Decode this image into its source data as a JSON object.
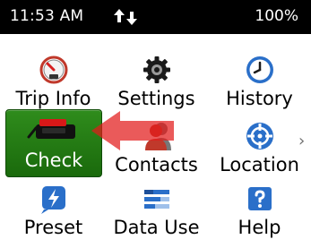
{
  "status_bar": {
    "time": "11:53 AM",
    "battery": "100%"
  },
  "menu": {
    "tiles": [
      {
        "label": "Trip Info",
        "icon": "speedometer-icon"
      },
      {
        "label": "Settings",
        "icon": "gear-icon"
      },
      {
        "label": "History",
        "icon": "clock-icon"
      },
      {
        "label": "Check",
        "icon": "handset-icon",
        "selected": true
      },
      {
        "label": "Contacts",
        "icon": "person-icon"
      },
      {
        "label": "Location",
        "icon": "crosshair-icon"
      },
      {
        "label": "Preset",
        "icon": "lightning-icon"
      },
      {
        "label": "Data Use",
        "icon": "bar-chart-icon"
      },
      {
        "label": "Help",
        "icon": "question-icon"
      }
    ]
  },
  "colors": {
    "selected_tile": "#2a7f18",
    "arrow": "#e21b1b",
    "status_bar": "#000000"
  }
}
